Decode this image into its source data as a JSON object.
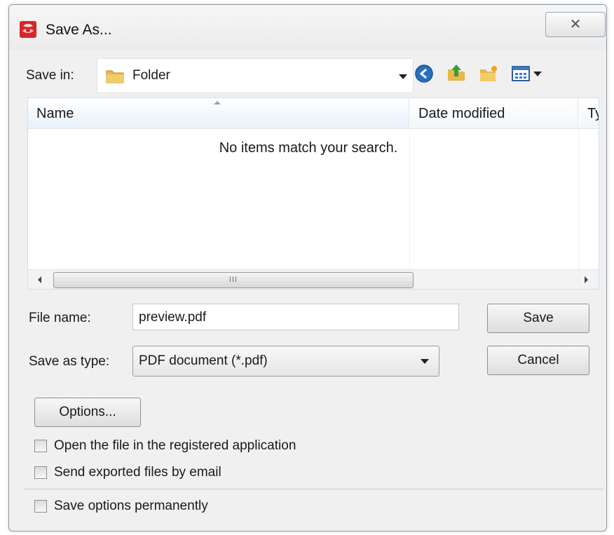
{
  "window": {
    "title": "Save As...",
    "close_glyph": "✕"
  },
  "save_in": {
    "label": "Save in:",
    "value": "Folder"
  },
  "toolbar_icons": [
    "back-icon",
    "up-folder-icon",
    "new-folder-icon",
    "view-menu-icon"
  ],
  "file_list": {
    "columns": [
      "Name",
      "Date modified",
      "Ty"
    ],
    "empty_message": "No items match your search.",
    "scroll_thumb_grip": "III"
  },
  "file_name": {
    "label": "File name:",
    "value": "preview.pdf"
  },
  "save_as_type": {
    "label": "Save as type:",
    "value": "PDF document (*.pdf)"
  },
  "buttons": {
    "save": "Save",
    "cancel": "Cancel",
    "options": "Options..."
  },
  "checkboxes": [
    {
      "label": "Open the file in the registered application",
      "checked": false
    },
    {
      "label": "Send exported files by email",
      "checked": false
    },
    {
      "label": "Save options permanently",
      "checked": false
    }
  ],
  "colors": {
    "app_icon_red": "#d7262b",
    "folder_yellow": "#e8b84a",
    "back_blue": "#2a6fc0",
    "up_green": "#3d9a3a"
  }
}
